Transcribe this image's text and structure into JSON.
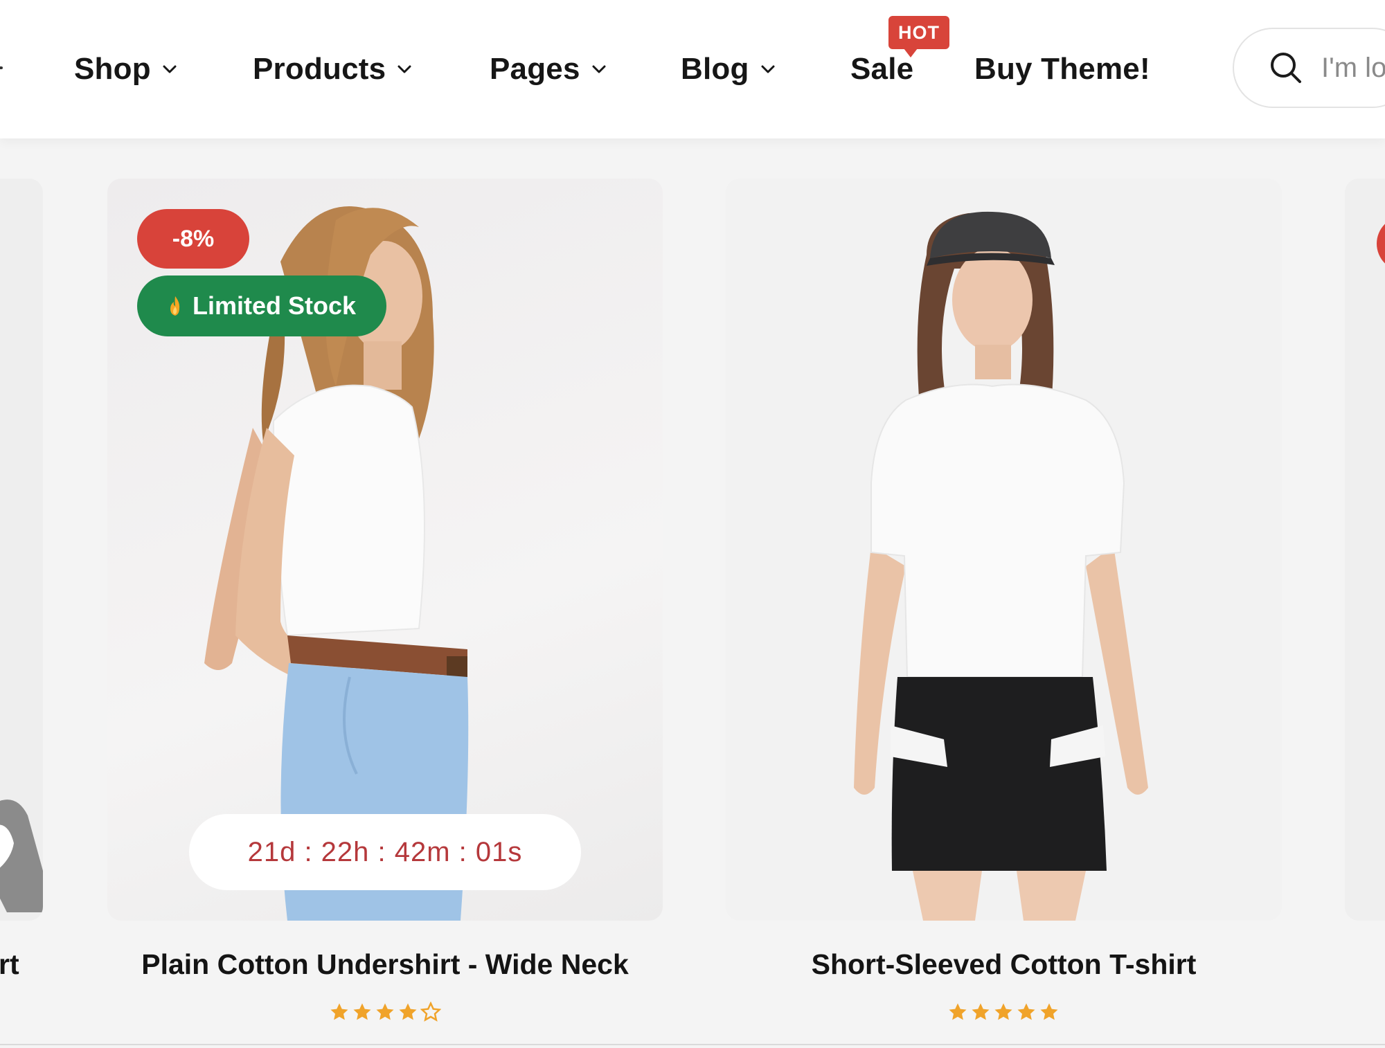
{
  "nav": {
    "items": [
      {
        "label": "Shop",
        "dropdown": true
      },
      {
        "label": "Products",
        "dropdown": true
      },
      {
        "label": "Pages",
        "dropdown": true
      },
      {
        "label": "Blog",
        "dropdown": true
      },
      {
        "label": "Sale",
        "dropdown": false
      },
      {
        "label": "Buy Theme!",
        "dropdown": false
      }
    ],
    "hot_badge": "HOT"
  },
  "search": {
    "placeholder": "I'm lo",
    "icon": "search-icon"
  },
  "products": [
    {
      "title": "Plain Cotton Undershirt - Wide Neck",
      "discount_badge": "-8%",
      "stock_badge": "Limited Stock",
      "stock_icon": "flame-icon",
      "countdown": "21d : 22h : 42m : 01s",
      "rating": 4,
      "image": "woman in white tank top and blue jeans"
    },
    {
      "title": "Short-Sleeved Cotton T-shirt",
      "rating": 5,
      "image": "woman in white t-shirt, black leather skirt and cap"
    }
  ],
  "partial_left_title": "rt",
  "colors": {
    "sale_red": "#d8433a",
    "stock_green": "#1f8a4c",
    "countdown_text": "#b5383b",
    "star": "#f0a32a"
  }
}
